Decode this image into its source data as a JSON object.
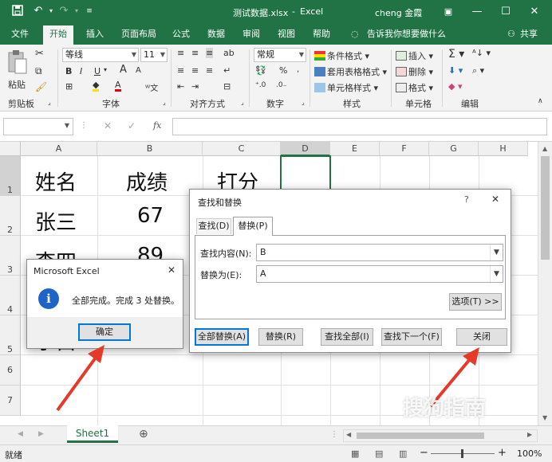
{
  "window": {
    "title_file": "测试数据.xlsx",
    "title_sep": "-",
    "title_app": "Excel",
    "user": "cheng 金霞"
  },
  "tabs": [
    "文件",
    "开始",
    "插入",
    "页面布局",
    "公式",
    "数据",
    "审阅",
    "视图",
    "帮助"
  ],
  "tell_me": "告诉我你想要做什么",
  "share": "共享",
  "ribbon": {
    "clipboard": {
      "paste": "粘贴",
      "label": "剪贴板"
    },
    "font": {
      "family": "等线",
      "size": "11",
      "label": "字体",
      "bold": "B",
      "italic": "I",
      "underline": "U",
      "grow": "A",
      "shrink": "A"
    },
    "alignment": {
      "label": "对齐方式"
    },
    "number": {
      "format": "常规",
      "label": "数字",
      "percent": "%"
    },
    "styles": {
      "cond": "条件格式",
      "table": "套用表格格式",
      "cell": "单元格样式",
      "label": "样式"
    },
    "cells": {
      "insert": "插入",
      "delete": "删除",
      "format": "格式",
      "label": "单元格"
    },
    "editing": {
      "label": "编辑"
    }
  },
  "formula_bar": {
    "name_box": "",
    "fx": "fx",
    "formula": ""
  },
  "grid": {
    "columns": [
      "A",
      "B",
      "C",
      "D",
      "E",
      "F",
      "G",
      "H"
    ],
    "rows": [
      "1",
      "2",
      "3",
      "4",
      "5",
      "6",
      "7"
    ],
    "cells": {
      "A1": "姓名",
      "B1": "成绩",
      "C1": "打分",
      "A2": "张三",
      "B2": "67",
      "A3": "李四",
      "B3": "89",
      "A5": "小白"
    }
  },
  "sheets": [
    "Sheet1"
  ],
  "status": {
    "ready": "就绪",
    "zoom": "100%",
    "minus": "−",
    "plus": "+"
  },
  "msgbox": {
    "title": "Microsoft Excel",
    "message": "全部完成。完成 3 处替换。",
    "ok": "确定",
    "info_glyph": "i"
  },
  "find_dialog": {
    "title": "查找和替换",
    "help": "?",
    "tab_find": "查找(D)",
    "tab_replace": "替换(P)",
    "find_label": "查找内容(N):",
    "find_value": "B",
    "replace_label": "替换为(E):",
    "replace_value": "A",
    "options": "选项(T) >>",
    "replace_all": "全部替换(A)",
    "replace": "替换(R)",
    "find_all": "查找全部(I)",
    "find_next": "查找下一个(F)",
    "close": "关闭"
  },
  "watermark": "搜狗指南"
}
